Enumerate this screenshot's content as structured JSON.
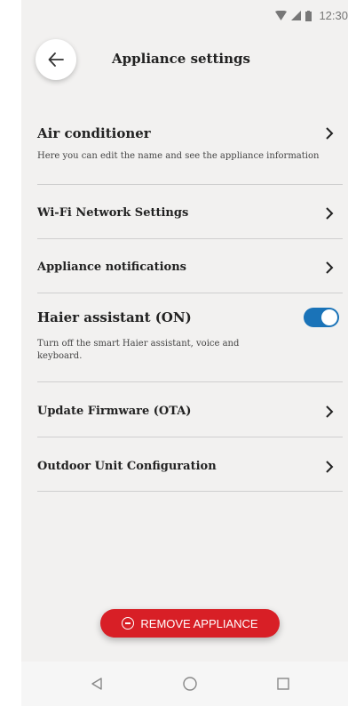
{
  "status_bar": {
    "time": "12:30",
    "icons": [
      "wifi-icon",
      "signal-icon",
      "battery-icon"
    ]
  },
  "header": {
    "title": "Appliance settings",
    "back_icon": "arrow-left-icon"
  },
  "settings": {
    "air_conditioner": {
      "label": "Air conditioner",
      "description": "Here you can edit the name and see the appliance information"
    },
    "wifi": {
      "label": "Wi-Fi Network Settings"
    },
    "notifications": {
      "label": "Appliance notifications"
    },
    "assistant": {
      "label": "Haier assistant (ON)",
      "description": "Turn off the smart Haier assistant, voice and keyboard.",
      "enabled": true
    },
    "firmware": {
      "label": "Update Firmware (OTA)"
    },
    "outdoor_unit": {
      "label": "Outdoor Unit Configuration"
    }
  },
  "remove_button": {
    "label": "REMOVE APPLIANCE",
    "icon": "minus-circle-icon"
  },
  "nav_bar": {
    "icons": [
      "back-triangle-icon",
      "home-circle-icon",
      "recents-square-icon"
    ]
  },
  "colors": {
    "accent": "#d81f26",
    "toggle": "#1a73b8",
    "background": "#f2f1f0"
  }
}
